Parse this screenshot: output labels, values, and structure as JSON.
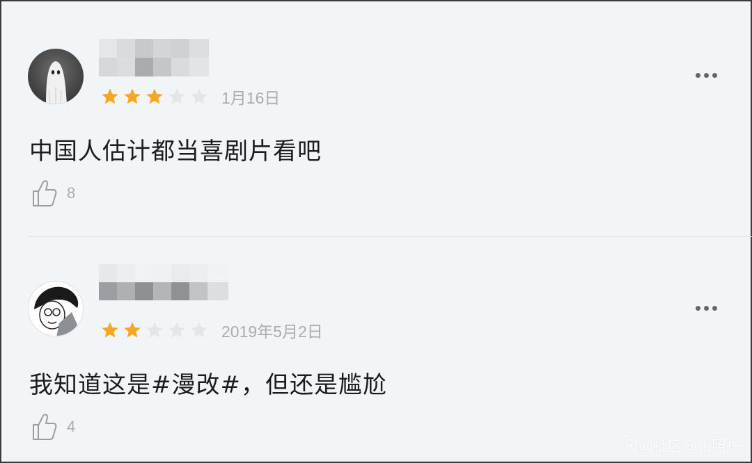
{
  "reviews": [
    {
      "rating": 3,
      "max_rating": 5,
      "date": "1月16日",
      "text": "中国人估计都当喜剧片看吧",
      "likes": "8"
    },
    {
      "rating": 2,
      "max_rating": 5,
      "date": "2019年5月2日",
      "text": "我知道这是#漫改#，但还是尴尬",
      "likes": "4"
    }
  ],
  "watermark": "风闻社区@张照栋",
  "colors": {
    "star_filled": "#f5a623",
    "star_empty": "#e3e5e8",
    "meta_text": "#a9adb2",
    "background": "#f1f5f8"
  },
  "icons": {
    "like": "thumbs-up-icon",
    "more": "more-icon"
  }
}
